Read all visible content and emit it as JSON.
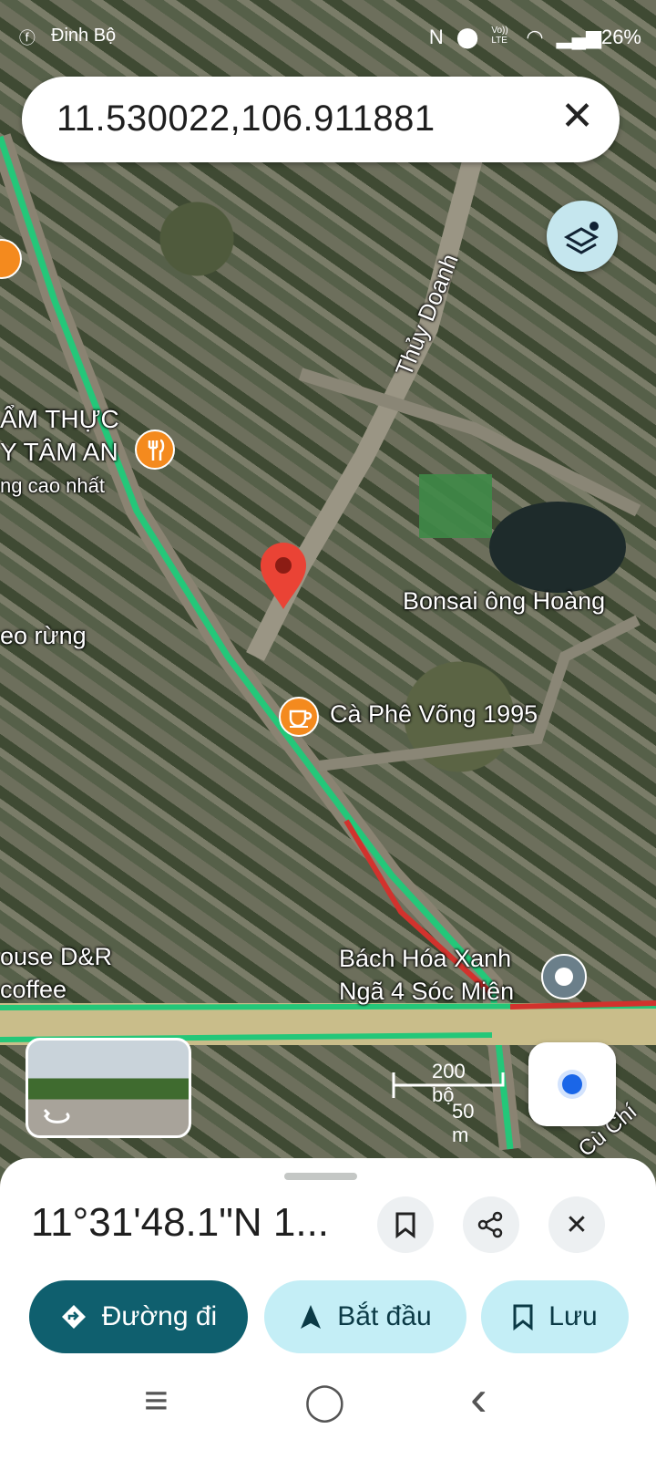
{
  "status_bar": {
    "left_text": "Đinh Bộ",
    "icons": [
      "facebook-icon",
      "nfc-icon",
      "location-icon",
      "volte-icon",
      "wifi-icon",
      "signal-icon",
      "battery-icon"
    ],
    "volte_label": "Vo)) LTE",
    "battery": "26%"
  },
  "search": {
    "query": "11.530022,106.911881",
    "clear_icon": "✕"
  },
  "map": {
    "labels": [
      {
        "key": "street_thuy_doanh",
        "text": "Thủy Doanh"
      },
      {
        "key": "am_thuc_1",
        "text": "ẨM THỰC"
      },
      {
        "key": "am_thuc_2",
        "text": "Y TÂM AN"
      },
      {
        "key": "am_thuc_3",
        "text": "ng cao nhất"
      },
      {
        "key": "bonsai",
        "text": "Bonsai ông Hoàng"
      },
      {
        "key": "eo_rung",
        "text": "eo rừng"
      },
      {
        "key": "ca_phe",
        "text": "Cà Phê Võng 1995"
      },
      {
        "key": "house_1",
        "text": "ouse D&R"
      },
      {
        "key": "house_2",
        "text": "coffee"
      },
      {
        "key": "bach_hoa_1",
        "text": "Bách Hóa Xanh"
      },
      {
        "key": "bach_hoa_2",
        "text": "Ngã 4 Sóc Miên"
      },
      {
        "key": "cu_chi",
        "text": "Cù Chí"
      }
    ],
    "scale": {
      "top": "200 bộ",
      "bottom": "50 m"
    },
    "accent_color": "#21b26f",
    "pin_color": "#ea4335"
  },
  "sheet": {
    "coordinates": "11°31'48.1\"N 1...",
    "save_icon": "bookmark-icon",
    "share_icon": "share-icon",
    "close_icon": "✕",
    "actions": [
      {
        "label": "Đường đi",
        "icon": "directions-icon"
      },
      {
        "label": "Bắt đầu",
        "icon": "navigation-arrow-icon"
      },
      {
        "label": "Lưu",
        "icon": "bookmark-icon"
      }
    ]
  },
  "nav_bar": {
    "recents": "≡",
    "home": "◯",
    "back": "‹"
  }
}
